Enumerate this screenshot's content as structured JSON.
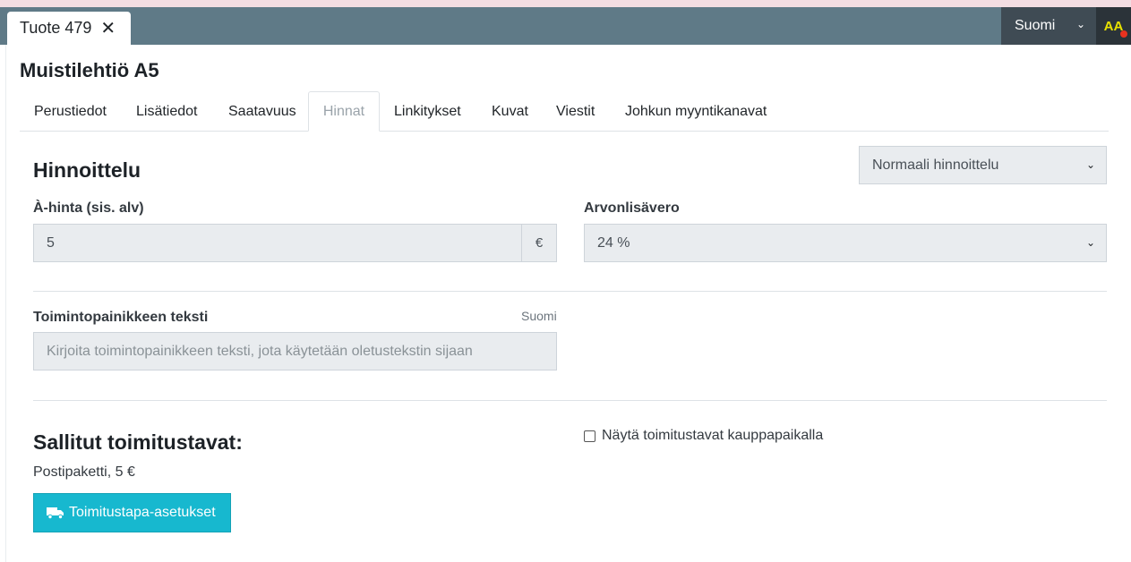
{
  "browser": {
    "tab_label": "Tuote 479",
    "close_glyph": "✕",
    "language_label": "Suomi",
    "accessibility_label": "AA"
  },
  "product": {
    "title": "Muistilehtiö A5"
  },
  "tabs": [
    {
      "label": "Perustiedot"
    },
    {
      "label": "Lisätiedot"
    },
    {
      "label": "Saatavuus"
    },
    {
      "label": "Hinnat",
      "active": true
    },
    {
      "label": "Linkitykset"
    },
    {
      "label": "Kuvat"
    },
    {
      "label": "Viestit"
    },
    {
      "label": "Johkun myyntikanavat"
    }
  ],
  "pricing": {
    "title": "Hinnoittelu",
    "mode_select": "Normaali hinnoittelu",
    "unit_price_label": "À-hinta (sis. alv)",
    "unit_price_value": "5",
    "currency": "€",
    "vat_label": "Arvonlisävero",
    "vat_value": "24 %"
  },
  "action_text": {
    "label": "Toimintopainikkeen teksti",
    "language": "Suomi",
    "placeholder": "Kirjoita toimintopainikkeen teksti, jota käytetään oletustekstin sijaan"
  },
  "shipping": {
    "title": "Sallitut toimitustavat:",
    "item": "Postipaketti, 5 €",
    "button_label": "Toimitustapa-asetukset",
    "checkbox_label": "Näytä toimitustavat kauppapaikalla",
    "checkbox_checked": false
  },
  "colors": {
    "topbar": "#5f7a87",
    "accent_button": "#17b8cf",
    "field_bg": "#e9ecef"
  }
}
